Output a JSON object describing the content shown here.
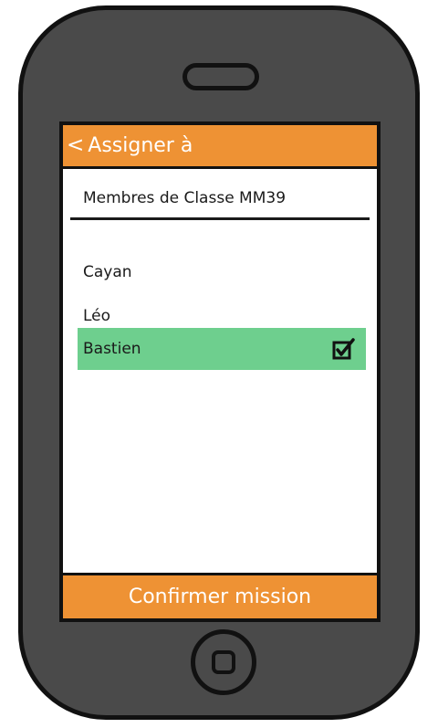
{
  "header": {
    "back_icon": "chevron-left-icon",
    "back_glyph": "<",
    "title": "Assigner à"
  },
  "list": {
    "label": "Membres de Classe MM39",
    "members": [
      {
        "name": "Cayan",
        "selected": false
      },
      {
        "name": "Léo",
        "selected": false
      },
      {
        "name": "Bastien",
        "selected": true
      }
    ]
  },
  "footer": {
    "confirm_label": "Confirmer mission"
  },
  "colors": {
    "accent": "#ee9234",
    "selected": "#6ecf8e",
    "device_body": "#4a4a4a"
  },
  "icons": {
    "checkbox": "checkbox-checked-icon",
    "home": "home-button-icon"
  }
}
